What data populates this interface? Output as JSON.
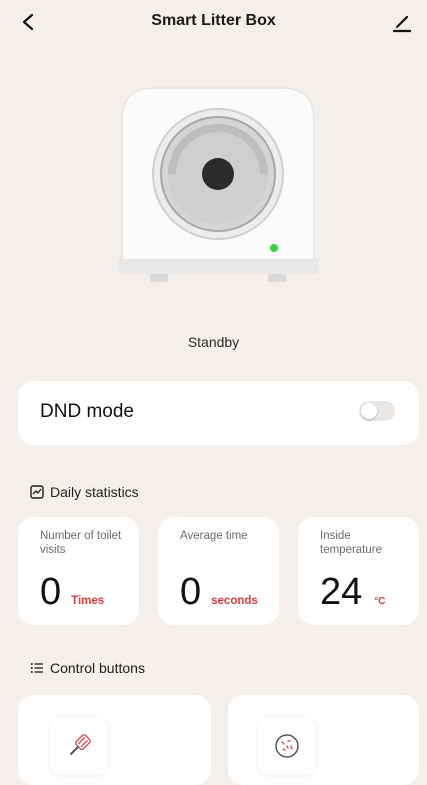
{
  "header": {
    "title": "Smart Litter Box",
    "back_icon": "chevron-left-icon",
    "edit_icon": "pencil-icon"
  },
  "device": {
    "status": "Standby",
    "indicator_color": "#3bd13b"
  },
  "dnd": {
    "label": "DND mode",
    "enabled": false
  },
  "daily_statistics": {
    "title": "Daily statistics",
    "icon": "chart-icon",
    "items": [
      {
        "label": "Number of toilet visits",
        "value": "0",
        "unit": "Times"
      },
      {
        "label": "Average time",
        "value": "0",
        "unit": "seconds"
      },
      {
        "label": "Inside temperature",
        "value": "24",
        "unit": "°C"
      }
    ]
  },
  "control_buttons": {
    "title": "Control buttons",
    "icon": "list-icon",
    "items": [
      {
        "icon": "scoop-icon"
      },
      {
        "icon": "litter-icon"
      }
    ]
  },
  "colors": {
    "background": "#f4efea",
    "card": "#ffffff",
    "unit_accent": "#d23b3b"
  }
}
